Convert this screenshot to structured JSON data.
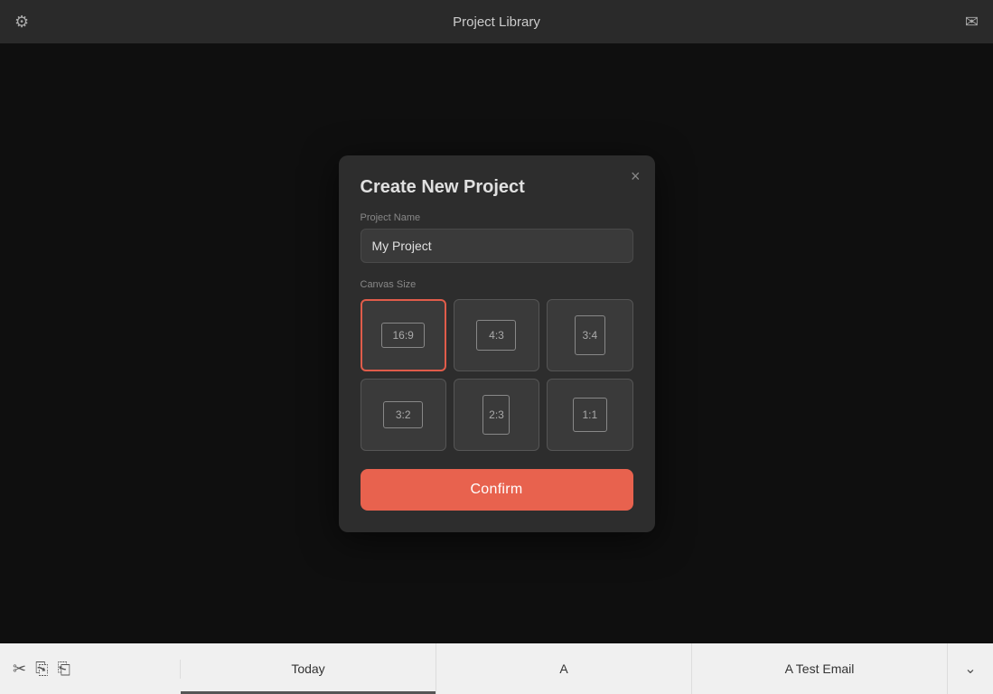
{
  "topBar": {
    "title": "Project Library",
    "gearIcon": "⚙",
    "inboxIcon": "✉"
  },
  "modal": {
    "title": "Create New Project",
    "closeIcon": "×",
    "projectNameLabel": "Project Name",
    "projectNameValue": "My Project",
    "projectNamePlaceholder": "My Project",
    "canvasSizeLabel": "Canvas Size",
    "canvasOptions": [
      {
        "id": "16-9",
        "label": "16:9",
        "selected": true
      },
      {
        "id": "4-3",
        "label": "4:3",
        "selected": false
      },
      {
        "id": "3-4",
        "label": "3:4",
        "selected": false
      },
      {
        "id": "3-2",
        "label": "3:2",
        "selected": false
      },
      {
        "id": "2-3",
        "label": "2:3",
        "selected": false
      },
      {
        "id": "1-1",
        "label": "1:1",
        "selected": false
      }
    ],
    "confirmLabel": "Confirm"
  },
  "bottomBar": {
    "icons": [
      "✂",
      "⎘",
      "⎗"
    ],
    "tabs": [
      {
        "label": "Today",
        "active": true
      },
      {
        "label": "A",
        "active": false
      },
      {
        "label": "A Test Email",
        "active": false
      }
    ],
    "moreIcon": "⌄"
  }
}
